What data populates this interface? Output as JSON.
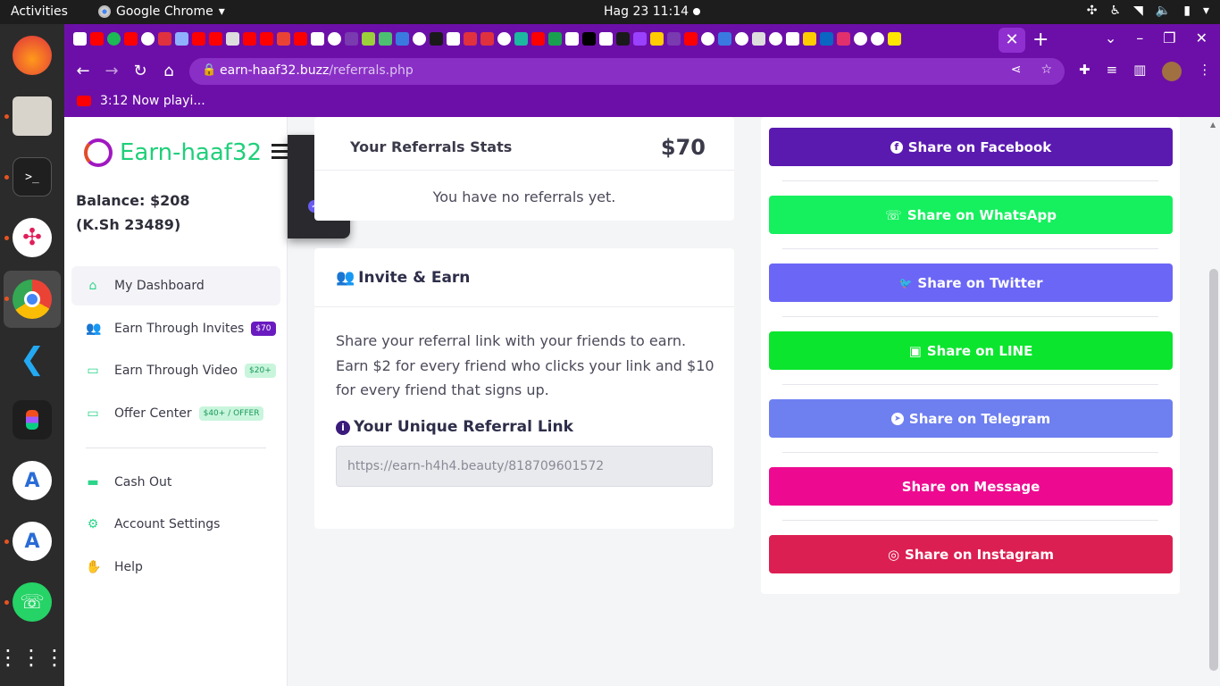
{
  "os": {
    "activities": "Activities",
    "app_name": "Google Chrome",
    "clock": "Hag 23  11:14"
  },
  "browser": {
    "url_host": "earn-haaf32.buzz",
    "url_path": "/referrals.php",
    "bookmark_label": "3:12 Now playi..."
  },
  "sidebar": {
    "brand": "Earn-haaf32",
    "balance_line1": "Balance: $208",
    "balance_line2": "(K.Sh 23489)",
    "items": [
      {
        "label": "My Dashboard",
        "icon": "home-icon"
      },
      {
        "label": "Earn Through Invites",
        "icon": "users-icon",
        "badge": "$70"
      },
      {
        "label": "Earn Through Video",
        "icon": "money-icon",
        "badge": "$20+"
      },
      {
        "label": "Offer Center",
        "icon": "money-icon",
        "badge": "$40+ / OFFER"
      },
      {
        "label": "Cash Out",
        "icon": "wallet-icon"
      },
      {
        "label": "Account Settings",
        "icon": "cogs-icon"
      },
      {
        "label": "Help",
        "icon": "handshake-icon"
      }
    ]
  },
  "stats": {
    "title": "Your Referrals Stats",
    "amount": "$70",
    "empty_text": "You have no referrals yet."
  },
  "invite": {
    "title": "Invite & Earn",
    "text": "Share your referral link with your friends to earn. Earn $2 for every friend who clicks your link and $10 for every friend that signs up.",
    "link_title": "Your Unique Referral Link",
    "link_value": "https://earn-h4h4.beauty/818709601572"
  },
  "share": {
    "buttons": [
      {
        "label": "Share on Facebook",
        "color": "#5a1ab0",
        "icon": "f"
      },
      {
        "label": "Share on WhatsApp",
        "color": "#16f05e",
        "icon": "☏"
      },
      {
        "label": "Share on Twitter",
        "color": "#6b66f5",
        "icon": "🐦"
      },
      {
        "label": "Share on LINE",
        "color": "#0be52e",
        "icon": "▣"
      },
      {
        "label": "Share on Telegram",
        "color": "#6e7ff0",
        "icon": "➤"
      },
      {
        "label": "Share on Message",
        "color": "#ed0a90",
        "icon": ""
      },
      {
        "label": "Share on Instagram",
        "color": "#dc1f52",
        "icon": "◎"
      }
    ]
  }
}
